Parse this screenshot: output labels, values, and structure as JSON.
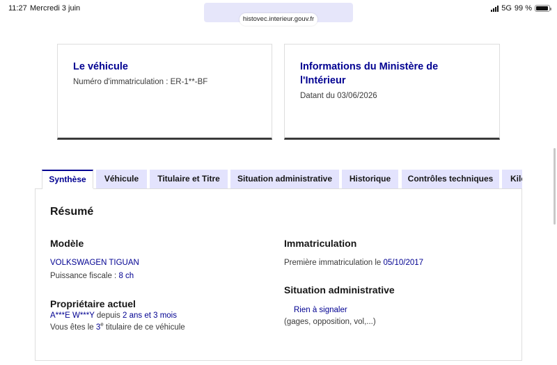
{
  "status_bar": {
    "time": "11:27",
    "date": "Mercredi 3 juin",
    "network": "5G",
    "battery": "99 %"
  },
  "browser": {
    "url": "histovec.interieur.gouv.fr"
  },
  "cards": {
    "vehicle": {
      "title": "Le véhicule",
      "text": "Numéro d'immatriculation : ER-1**-BF"
    },
    "ministry": {
      "title_line1": "Informations du Ministère de",
      "title_line2": "l'Intérieur",
      "text": "Datant du 03/06/2026"
    }
  },
  "tabs": [
    {
      "label": "Synthèse",
      "active": true
    },
    {
      "label": "Véhicule",
      "active": false
    },
    {
      "label": "Titulaire et Titre",
      "active": false
    },
    {
      "label": "Situation administrative",
      "active": false
    },
    {
      "label": "Historique",
      "active": false
    },
    {
      "label": "Contrôles techniques",
      "active": false
    },
    {
      "label": "Kilométrage",
      "active": false
    }
  ],
  "summary": {
    "title": "Résumé",
    "model": {
      "heading": "Modèle",
      "name": "VOLKSWAGEN TIGUAN",
      "power_label": "Puissance fiscale : ",
      "power_value": "8 ch"
    },
    "owner": {
      "heading": "Propriétaire actuel",
      "name": "A***E W***Y",
      "since_label": " depuis ",
      "since_value": "2 ans et 3 mois",
      "rank_prefix": "Vous êtes le ",
      "rank_number": "3",
      "rank_suffix": "e",
      "rank_rest": " titulaire de ce véhicule"
    },
    "registration": {
      "heading": "Immatriculation",
      "label": "Première immatriculation le ",
      "date": "05/10/2017"
    },
    "admin": {
      "heading": "Situation administrative",
      "status": "Rien à signaler",
      "note": "(gages, opposition, vol,...)"
    }
  }
}
